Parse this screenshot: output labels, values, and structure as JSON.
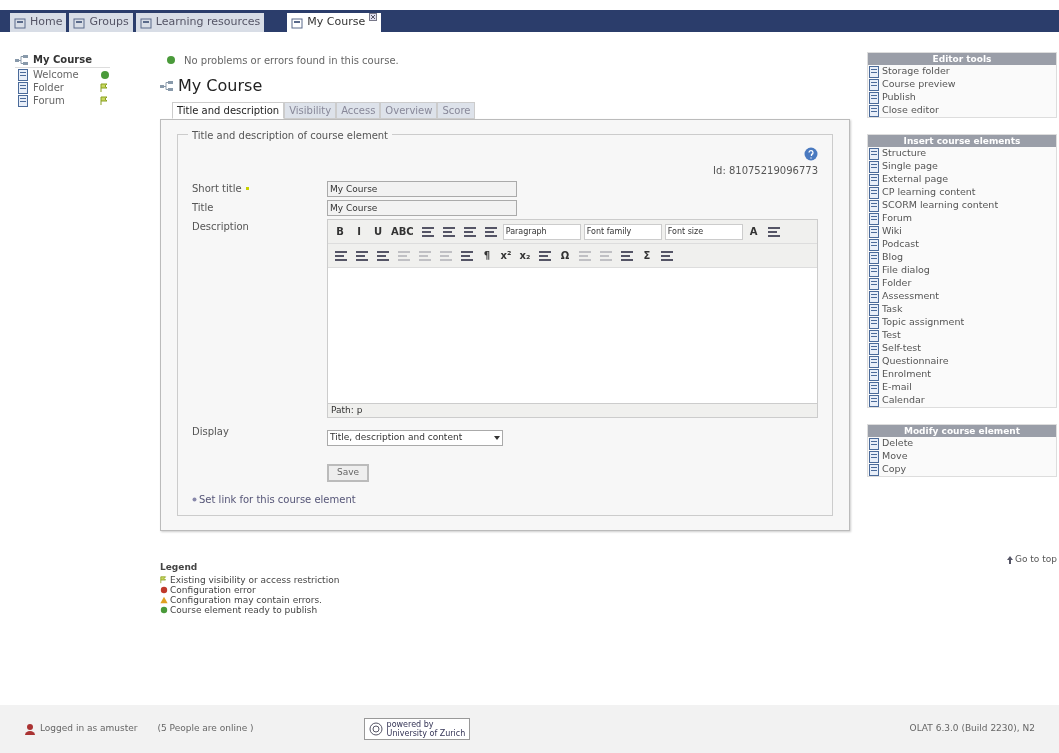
{
  "nav_tabs": [
    {
      "label": "Home",
      "selected": false
    },
    {
      "label": "Groups",
      "selected": false
    },
    {
      "label": "Learning resources",
      "selected": false
    },
    {
      "label": "My Course",
      "selected": true,
      "closable": true
    }
  ],
  "tree": {
    "label": "My Course",
    "children": [
      {
        "label": "Welcome",
        "kind": "ready"
      },
      {
        "label": "Folder",
        "kind": "restricted"
      },
      {
        "label": "Forum",
        "kind": "restricted"
      }
    ]
  },
  "status_message": "No problems or errors found in this course.",
  "course_title": "My Course",
  "tabs": [
    {
      "label": "Title and description",
      "selected": true
    },
    {
      "label": "Visibility",
      "selected": false
    },
    {
      "label": "Access",
      "selected": false
    },
    {
      "label": "Overview",
      "selected": false
    },
    {
      "label": "Score",
      "selected": false
    }
  ],
  "form": {
    "legend": "Title and description of course element",
    "id_text": "Id: 81075219096773",
    "short_title": {
      "label": "Short title",
      "required": true,
      "value": "My Course"
    },
    "title": {
      "label": "Title",
      "value": "My Course"
    },
    "description": {
      "label": "Description",
      "toolbar_row1": [
        {
          "kind": "text",
          "text": "B"
        },
        {
          "kind": "text",
          "text": "I"
        },
        {
          "kind": "text",
          "text": "U"
        },
        {
          "kind": "text",
          "text": "ABC"
        },
        {
          "kind": "icon"
        },
        {
          "kind": "icon"
        },
        {
          "kind": "icon"
        },
        {
          "kind": "icon"
        },
        {
          "kind": "select",
          "text": "Paragraph"
        },
        {
          "kind": "select",
          "text": "Font family"
        },
        {
          "kind": "select",
          "text": "Font size"
        },
        {
          "kind": "text",
          "text": "A"
        },
        {
          "kind": "icon"
        }
      ],
      "toolbar_row2": [
        {
          "kind": "icon"
        },
        {
          "kind": "icon"
        },
        {
          "kind": "icon"
        },
        {
          "kind": "icon",
          "disabled": true
        },
        {
          "kind": "icon",
          "disabled": true
        },
        {
          "kind": "icon",
          "disabled": true
        },
        {
          "kind": "icon"
        },
        {
          "kind": "text",
          "text": "¶"
        },
        {
          "kind": "text",
          "text": "x²"
        },
        {
          "kind": "text",
          "text": "x₂"
        },
        {
          "kind": "icon"
        },
        {
          "kind": "text",
          "text": "Ω"
        },
        {
          "kind": "icon",
          "disabled": true
        },
        {
          "kind": "icon",
          "disabled": true
        },
        {
          "kind": "icon"
        },
        {
          "kind": "text",
          "text": "Σ"
        },
        {
          "kind": "icon"
        }
      ],
      "path": "Path: p"
    },
    "display": {
      "label": "Display",
      "value": "Title, description and content"
    },
    "save": "Save",
    "link": "Set link for this course element"
  },
  "legend": {
    "title": "Legend",
    "items": [
      {
        "kind": "restricted",
        "text": "Existing visibility or access restriction"
      },
      {
        "kind": "error",
        "text": "Configuration error"
      },
      {
        "kind": "warning",
        "text": "Configuration may contain errors."
      },
      {
        "kind": "ready",
        "text": "Course element ready to publish"
      }
    ]
  },
  "sidebar": [
    {
      "title": "Editor tools",
      "items": [
        "Storage folder",
        "Course preview",
        "Publish",
        "Close editor"
      ]
    },
    {
      "title": "Insert course elements",
      "items": [
        "Structure",
        "Single page",
        "External page",
        "CP learning content",
        "SCORM learning content",
        "Forum",
        "Wiki",
        "Podcast",
        "Blog",
        "File dialog",
        "Folder",
        "Assessment",
        "Task",
        "Topic assignment",
        "Test",
        "Self-test",
        "Questionnaire",
        "Enrolment",
        "E-mail",
        "Calendar"
      ]
    },
    {
      "title": "Modify course element",
      "items": [
        "Delete",
        "Move",
        "Copy"
      ]
    }
  ],
  "go_to_top": "Go to top",
  "footer": {
    "logged_in": "Logged in as amuster",
    "online": "(5 People are online )",
    "powered_by": "powered by",
    "university": "University of Zurich",
    "version": "OLAT 6.3.0 (Build 2230), N2"
  }
}
